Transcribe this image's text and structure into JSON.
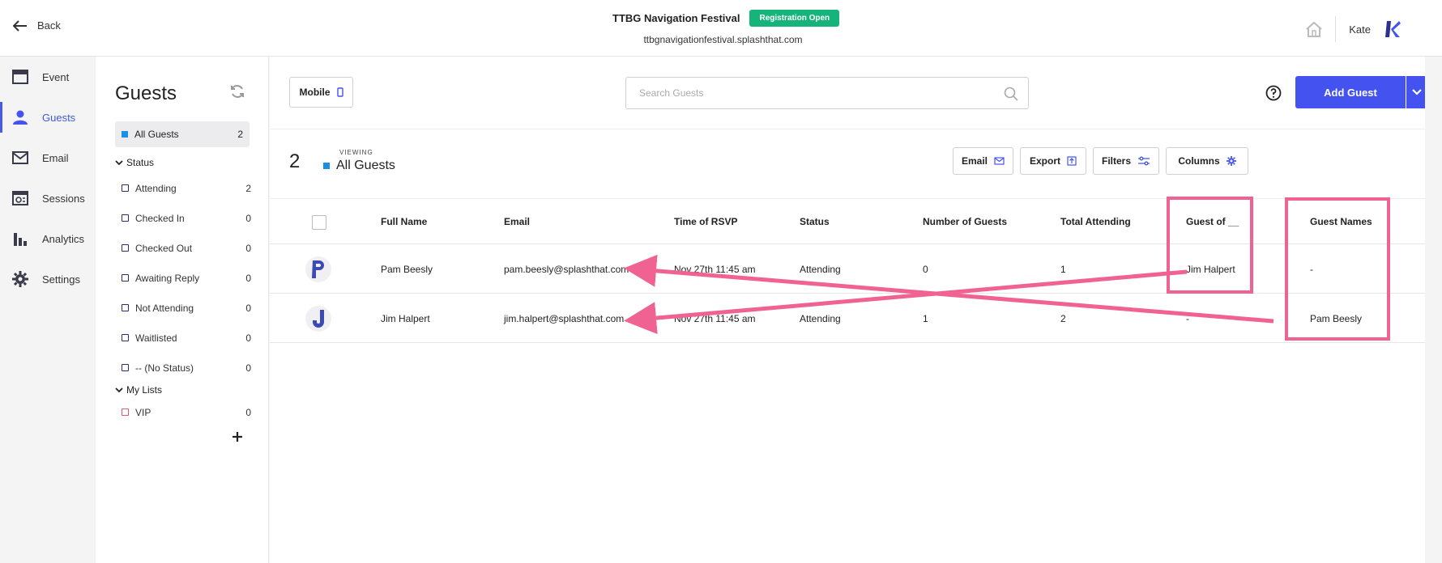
{
  "header": {
    "back_label": "Back",
    "event_name": "TTBG Navigation Festival",
    "status_badge": "Registration Open",
    "event_url": "ttbgnavigationfestival.splashthat.com",
    "user_name": "Kate"
  },
  "nav": {
    "items": [
      {
        "label": "Event",
        "icon": "calendar-icon"
      },
      {
        "label": "Guests",
        "icon": "person-icon",
        "active": true
      },
      {
        "label": "Email",
        "icon": "envelope-icon"
      },
      {
        "label": "Sessions",
        "icon": "sessions-icon"
      },
      {
        "label": "Analytics",
        "icon": "bar-chart-icon"
      },
      {
        "label": "Settings",
        "icon": "gear-icon"
      }
    ]
  },
  "guests_sidebar": {
    "title": "Guests",
    "all_guests": {
      "label": "All Guests",
      "count": "2"
    },
    "status_section": "Status",
    "statuses": [
      {
        "label": "Attending",
        "count": "2"
      },
      {
        "label": "Checked In",
        "count": "0"
      },
      {
        "label": "Checked Out",
        "count": "0"
      },
      {
        "label": "Awaiting Reply",
        "count": "0"
      },
      {
        "label": "Not Attending",
        "count": "0"
      },
      {
        "label": "Waitlisted",
        "count": "0"
      },
      {
        "label": "-- (No Status)",
        "count": "0"
      }
    ],
    "lists_section": "My Lists",
    "lists": [
      {
        "label": "VIP",
        "count": "0"
      }
    ]
  },
  "toolbar": {
    "mobile_label": "Mobile",
    "search_placeholder": "Search Guests",
    "add_guest_label": "Add Guest"
  },
  "view": {
    "count": "2",
    "viewing_label": "VIEWING",
    "name": "All Guests",
    "actions": {
      "email": "Email",
      "export": "Export",
      "filters": "Filters",
      "columns": "Columns"
    }
  },
  "table": {
    "columns": [
      "Full Name",
      "Email",
      "Time of RSVP",
      "Status",
      "Number of Guests",
      "Total Attending",
      "Guest of __",
      "Guest Names"
    ],
    "rows": [
      {
        "avatar": "P",
        "full_name": "Pam Beesly",
        "email": "pam.beesly@splashthat.com",
        "rsvp": "Nov 27th 11:45 am",
        "status": "Attending",
        "num_guests": "0",
        "total": "1",
        "guest_of": "Jim Halpert",
        "guest_names": "-"
      },
      {
        "avatar": "J",
        "full_name": "Jim Halpert",
        "email": "jim.halpert@splashthat.com",
        "rsvp": "Nov 27th 11:45 am",
        "status": "Attending",
        "num_guests": "1",
        "total": "2",
        "guest_of": "-",
        "guest_names": "Pam Beesly"
      }
    ]
  },
  "colors": {
    "accent": "#4453f0",
    "badge": "#16b47a",
    "annotation": "#f06292"
  }
}
